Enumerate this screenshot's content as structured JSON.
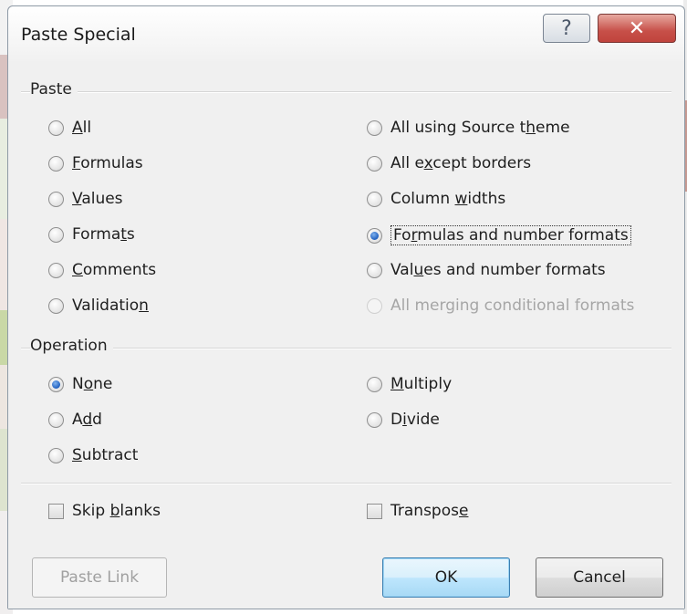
{
  "window": {
    "title": "Paste Special",
    "help_label": "?",
    "close_label": "✕"
  },
  "paste": {
    "label": "Paste",
    "left": [
      {
        "text": "All",
        "accel": "A",
        "pre": "",
        "post": "ll",
        "selected": false
      },
      {
        "text": "Formulas",
        "pre": "",
        "accel": "F",
        "post": "ormulas",
        "selected": false
      },
      {
        "text": "Values",
        "pre": "",
        "accel": "V",
        "post": "alues",
        "selected": false
      },
      {
        "text": "Formats",
        "pre": "Forma",
        "accel": "t",
        "post": "s",
        "selected": false
      },
      {
        "text": "Comments",
        "pre": "",
        "accel": "C",
        "post": "omments",
        "selected": false
      },
      {
        "text": "Validation",
        "pre": "Validatio",
        "accel": "n",
        "post": "",
        "selected": false
      }
    ],
    "right": [
      {
        "text": "All using Source theme",
        "pre": "All using Source t",
        "accel": "h",
        "post": "eme",
        "selected": false
      },
      {
        "text": "All except borders",
        "pre": "All e",
        "accel": "x",
        "post": "cept borders",
        "selected": false
      },
      {
        "text": "Column widths",
        "pre": "Column ",
        "accel": "w",
        "post": "idths",
        "selected": false
      },
      {
        "text": "Formulas and number formats",
        "pre": "Fo",
        "accel": "r",
        "post": "mulas and number formats",
        "selected": true
      },
      {
        "text": "Values and number formats",
        "pre": "Val",
        "accel": "u",
        "post": "es and number formats",
        "selected": false
      },
      {
        "text": "All merging conditional formats",
        "pre": "All merging conditional formats",
        "accel": "",
        "post": "",
        "selected": false,
        "disabled": true
      }
    ]
  },
  "operation": {
    "label": "Operation",
    "left": [
      {
        "text": "None",
        "pre": "N",
        "accel": "o",
        "post": "ne",
        "selected": true
      },
      {
        "text": "Add",
        "pre": "A",
        "accel": "d",
        "post": "d",
        "selected": false
      },
      {
        "text": "Subtract",
        "pre": "",
        "accel": "S",
        "post": "ubtract",
        "selected": false
      }
    ],
    "right": [
      {
        "text": "Multiply",
        "pre": "",
        "accel": "M",
        "post": "ultiply",
        "selected": false
      },
      {
        "text": "Divide",
        "pre": "D",
        "accel": "i",
        "post": "vide",
        "selected": false
      }
    ]
  },
  "checks": {
    "skip_blanks": {
      "pre": "Skip ",
      "accel": "b",
      "post": "lanks",
      "checked": false
    },
    "transpose": {
      "pre": "Transpos",
      "accel": "e",
      "post": "",
      "checked": false
    }
  },
  "buttons": {
    "paste_link": "Paste Link",
    "ok": "OK",
    "cancel": "Cancel"
  }
}
